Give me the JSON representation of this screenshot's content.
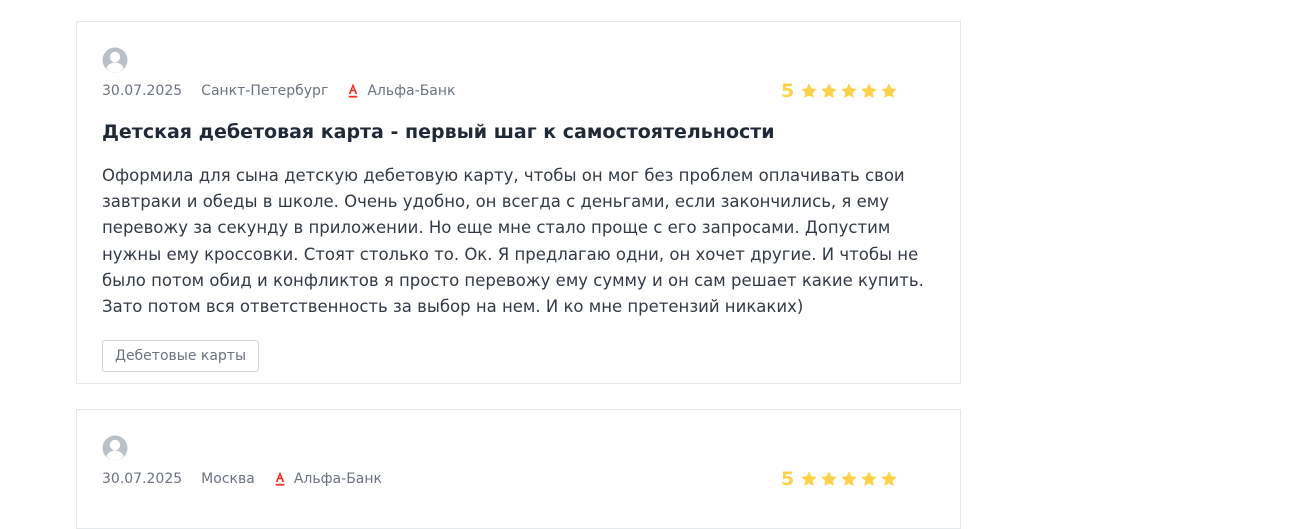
{
  "colors": {
    "star": "#fdd14a",
    "bank_logo": "#ef3124",
    "border": "#e5e7eb",
    "muted_text": "#6b7280"
  },
  "reviews": [
    {
      "date": "30.07.2025",
      "city": "Санкт-Петербург",
      "bank": "Альфа-Банк",
      "bank_icon": "alfa-bank-logo",
      "rating": "5",
      "stars": 5,
      "title": "Детская дебетовая карта - первый шаг к самостоятельности",
      "text": "Оформила для сына детскую дебетовую карту, чтобы он мог без проблем оплачивать свои завтраки и обеды в школе. Очень удобно, он всегда с деньгами, если закончились, я ему перевожу за секунду в приложении. Но еще мне стало проще с его запросами. Допустим нужны ему кроссовки. Стоят столько то. Ок. Я предлагаю одни, он хочет другие. И чтобы не было потом обид и конфликтов я просто перевожу ему сумму и он сам решает какие купить. Зато потом вся ответственность за выбор на нем. И ко мне претензий никаких)",
      "tag": "Дебетовые карты"
    },
    {
      "date": "30.07.2025",
      "city": "Москва",
      "bank": "Альфа-Банк",
      "bank_icon": "alfa-bank-logo",
      "rating": "5",
      "stars": 5
    }
  ]
}
